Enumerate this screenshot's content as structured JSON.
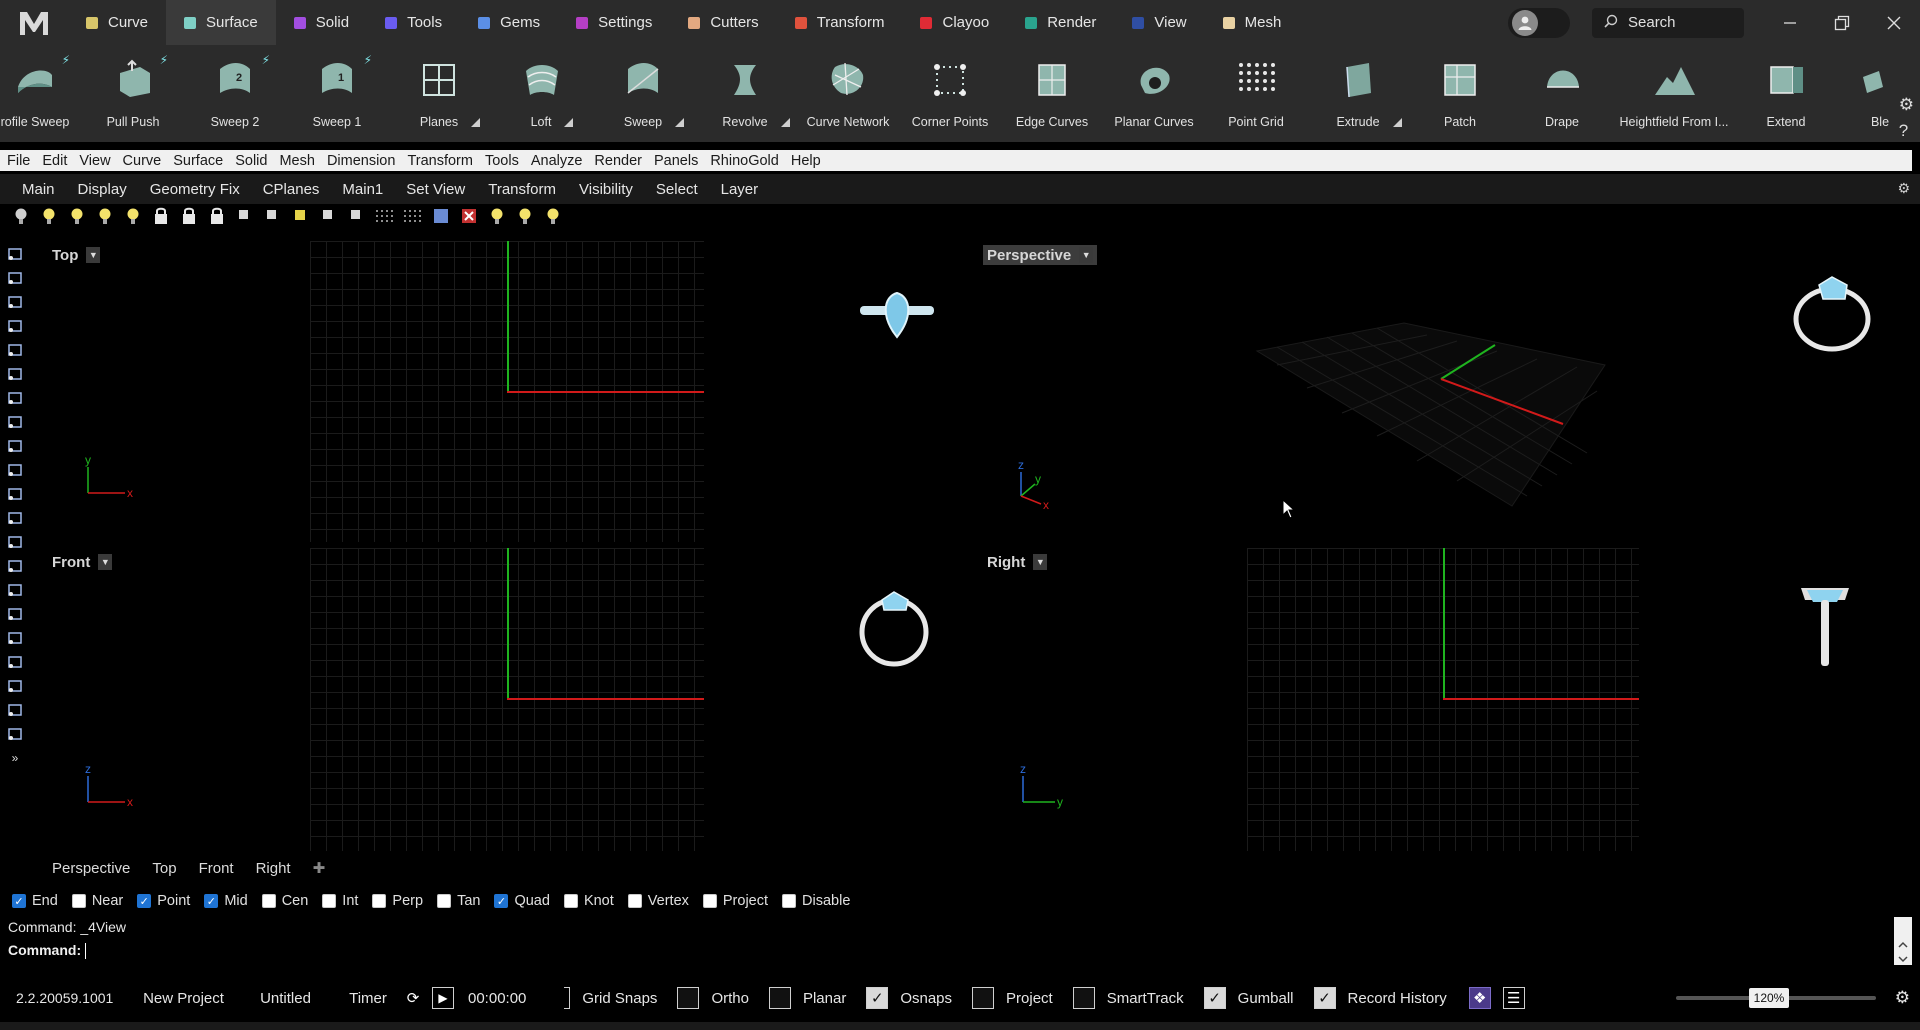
{
  "app": {
    "tabs": [
      {
        "label": "Curve",
        "color": "#d8c66a"
      },
      {
        "label": "Surface",
        "color": "#7fd0c6",
        "active": true
      },
      {
        "label": "Solid",
        "color": "#a24ee0"
      },
      {
        "label": "Tools",
        "color": "#6a5cf0"
      },
      {
        "label": "Gems",
        "color": "#5b8fe6"
      },
      {
        "label": "Settings",
        "color": "#b53fc5"
      },
      {
        "label": "Cutters",
        "color": "#e3a981"
      },
      {
        "label": "Transform",
        "color": "#e0523d"
      },
      {
        "label": "Clayoo",
        "color": "#e02b35"
      },
      {
        "label": "Render",
        "color": "#2aa48e"
      },
      {
        "label": "View",
        "color": "#2f4ea3"
      },
      {
        "label": "Mesh",
        "color": "#e9d2a3"
      }
    ],
    "search_label": "Search"
  },
  "ribbon": {
    "buttons": [
      {
        "label": "rofile Sweep",
        "icon": "profile-sweep-icon",
        "bolt": true
      },
      {
        "label": "Pull Push",
        "icon": "pull-push-icon",
        "bolt": true
      },
      {
        "label": "Sweep 2",
        "icon": "sweep-2-icon",
        "bolt": true
      },
      {
        "label": "Sweep 1",
        "icon": "sweep-1-icon",
        "bolt": true
      },
      {
        "label": "Planes",
        "icon": "planes-icon",
        "more": true
      },
      {
        "label": "Loft",
        "icon": "loft-icon",
        "more": true
      },
      {
        "label": "Sweep",
        "icon": "sweep-icon",
        "more": true
      },
      {
        "label": "Revolve",
        "icon": "revolve-icon",
        "more": true
      },
      {
        "label": "Curve Network",
        "icon": "curve-network-icon"
      },
      {
        "label": "Corner Points",
        "icon": "corner-points-icon"
      },
      {
        "label": "Edge Curves",
        "icon": "edge-curves-icon"
      },
      {
        "label": "Planar Curves",
        "icon": "planar-curves-icon"
      },
      {
        "label": "Point Grid",
        "icon": "point-grid-icon"
      },
      {
        "label": "Extrude",
        "icon": "extrude-icon",
        "more": true
      },
      {
        "label": "Patch",
        "icon": "patch-icon"
      },
      {
        "label": "Drape",
        "icon": "drape-icon"
      },
      {
        "label": "Heightfield From I...",
        "icon": "heightfield-icon"
      },
      {
        "label": "Extend",
        "icon": "extend-icon"
      },
      {
        "label": "Ble",
        "icon": "blend-icon"
      }
    ]
  },
  "menubar": [
    "File",
    "Edit",
    "View",
    "Curve",
    "Surface",
    "Solid",
    "Mesh",
    "Dimension",
    "Transform",
    "Tools",
    "Analyze",
    "Render",
    "Panels",
    "RhinoGold",
    "Help"
  ],
  "toolbar_tabs": [
    "Main",
    "Display",
    "Geometry Fix",
    "CPlanes",
    "Main1",
    "Set View",
    "Transform",
    "Visibility",
    "Select",
    "Layer"
  ],
  "viewports": {
    "top": {
      "title": "Top"
    },
    "perspective": {
      "title": "Perspective"
    },
    "front": {
      "title": "Front"
    },
    "right": {
      "title": "Right"
    }
  },
  "axis_labels": {
    "x": "x",
    "y": "y",
    "z": "z"
  },
  "viewport_tabs": [
    "Perspective",
    "Top",
    "Front",
    "Right"
  ],
  "osnaps": [
    {
      "label": "End",
      "checked": true
    },
    {
      "label": "Near",
      "checked": false
    },
    {
      "label": "Point",
      "checked": true
    },
    {
      "label": "Mid",
      "checked": true
    },
    {
      "label": "Cen",
      "checked": false
    },
    {
      "label": "Int",
      "checked": false
    },
    {
      "label": "Perp",
      "checked": false
    },
    {
      "label": "Tan",
      "checked": false
    },
    {
      "label": "Quad",
      "checked": true
    },
    {
      "label": "Knot",
      "checked": false
    },
    {
      "label": "Vertex",
      "checked": false
    },
    {
      "label": "Project",
      "checked": false
    },
    {
      "label": "Disable",
      "checked": false
    }
  ],
  "command": {
    "history": "Command: _4View",
    "prompt": "Command:"
  },
  "status": {
    "version": "2.2.20059.1001",
    "project": "New Project",
    "file": "Untitled",
    "timer_label": "Timer",
    "timer_value": "00:00:00",
    "toggles": [
      {
        "label": "Grid Snaps",
        "on": false
      },
      {
        "label": "Ortho",
        "on": false
      },
      {
        "label": "Planar",
        "on": false
      },
      {
        "label": "Osnaps",
        "on": true
      },
      {
        "label": "Project",
        "on": false
      },
      {
        "label": "SmartTrack",
        "on": false
      },
      {
        "label": "Gumball",
        "on": true
      },
      {
        "label": "Record History",
        "on": true
      }
    ],
    "zoom": "120%"
  }
}
